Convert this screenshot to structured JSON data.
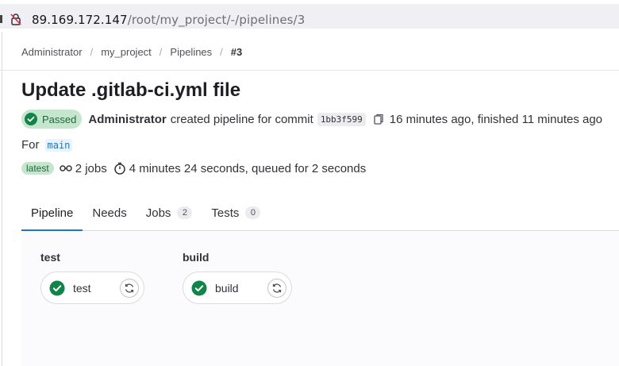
{
  "browser": {
    "url_host": "89.169.172.147",
    "url_path": "/root/my_project/-/pipelines/3"
  },
  "breadcrumb": [
    "Administrator",
    "my_project",
    "Pipelines",
    "#3"
  ],
  "pipeline": {
    "title": "Update .gitlab-ci.yml file",
    "status_label": "Passed",
    "author": "Administrator",
    "action_text": "created pipeline for commit",
    "commit_sha": "1bb3f599",
    "timing_text": "16 minutes ago, finished 11 minutes ago",
    "for_label": "For",
    "ref": "main",
    "latest_badge": "latest",
    "jobs_text": "2 jobs",
    "duration_text": "4 minutes 24 seconds, queued for 2 seconds"
  },
  "tabs": [
    {
      "label": "Pipeline",
      "count": null
    },
    {
      "label": "Needs",
      "count": null
    },
    {
      "label": "Jobs",
      "count": "2"
    },
    {
      "label": "Tests",
      "count": "0"
    }
  ],
  "stages": [
    {
      "name": "test",
      "jobs": [
        {
          "name": "test",
          "status": "passed"
        }
      ]
    },
    {
      "name": "build",
      "jobs": [
        {
          "name": "build",
          "status": "passed"
        }
      ]
    }
  ],
  "colors": {
    "success": "#108548",
    "link": "#1f75cb",
    "tab_active": "#1f75cb"
  }
}
